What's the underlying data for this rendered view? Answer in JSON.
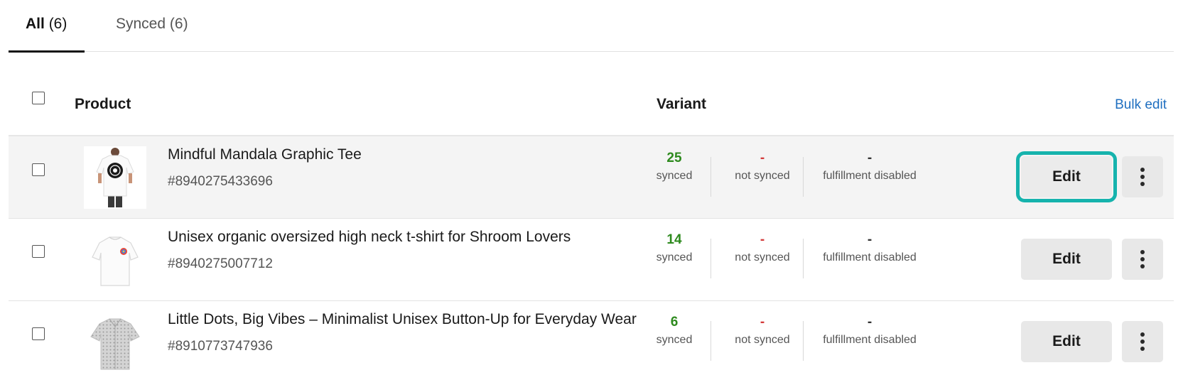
{
  "tabs": [
    {
      "label": "All",
      "count": "(6)",
      "active": true
    },
    {
      "label": "Synced",
      "count": "(6)",
      "active": false
    }
  ],
  "table": {
    "headers": {
      "product": "Product",
      "variant": "Variant"
    },
    "bulk_edit_label": "Bulk edit"
  },
  "rows": [
    {
      "name": "Mindful Mandala Graphic Tee",
      "id": "#8940275433696",
      "synced": "25",
      "synced_label": "synced",
      "not_synced": "-",
      "not_synced_label": "not synced",
      "fulfillment": "-",
      "fulfillment_label": "fulfillment disabled",
      "edit_label": "Edit",
      "thumbnail": "tee-mandala-icon"
    },
    {
      "name": "Unisex organic oversized high neck t-shirt for Shroom Lovers",
      "id": "#8940275007712",
      "synced": "14",
      "synced_label": "synced",
      "not_synced": "-",
      "not_synced_label": "not synced",
      "fulfillment": "-",
      "fulfillment_label": "fulfillment disabled",
      "edit_label": "Edit",
      "thumbnail": "tee-white-icon"
    },
    {
      "name": "Little Dots, Big Vibes – Minimalist Unisex Button-Up for Everyday Wear",
      "id": "#8910773747936",
      "synced": "6",
      "synced_label": "synced",
      "not_synced": "-",
      "not_synced_label": "not synced",
      "fulfillment": "-",
      "fulfillment_label": "fulfillment disabled",
      "edit_label": "Edit",
      "thumbnail": "button-up-shirt-icon"
    }
  ],
  "colors": {
    "synced": "#2e8a1e",
    "not_synced": "#d43b3b",
    "focus_ring": "#16b3ad",
    "link": "#1f6fc0"
  }
}
